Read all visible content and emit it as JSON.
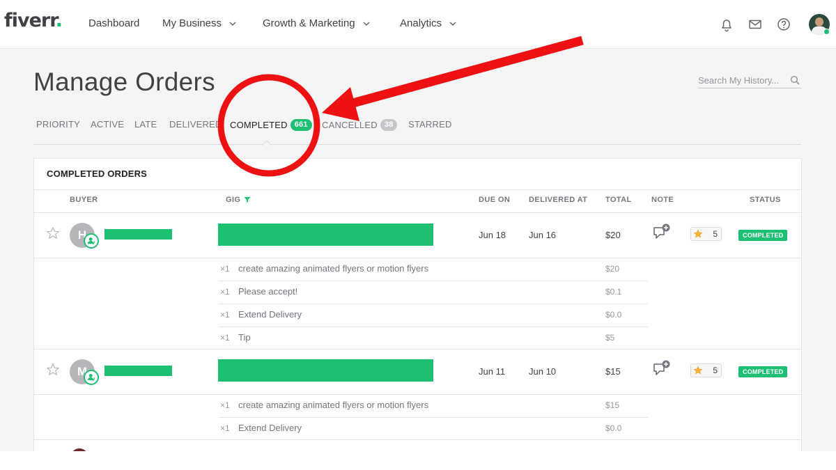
{
  "header": {
    "logo": "fiverr",
    "logo_dot": ".",
    "nav": [
      "Dashboard",
      "My Business",
      "Growth & Marketing",
      "Analytics"
    ]
  },
  "page": {
    "title": "Manage Orders",
    "search_placeholder": "Search My History..."
  },
  "tabs": [
    {
      "label": "PRIORITY"
    },
    {
      "label": "ACTIVE"
    },
    {
      "label": "LATE"
    },
    {
      "label": "DELIVERED"
    },
    {
      "label": "COMPLETED",
      "count": "661"
    },
    {
      "label": "CANCELLED",
      "count": "38"
    },
    {
      "label": "STARRED"
    }
  ],
  "table": {
    "title": "COMPLETED ORDERS",
    "columns": [
      "BUYER",
      "GIG",
      "DUE ON",
      "DELIVERED AT",
      "TOTAL",
      "NOTE",
      "STATUS"
    ],
    "orders": [
      {
        "initial": "H",
        "due": "Jun 18",
        "delivered": "Jun 16",
        "total": "$20",
        "rating": "5",
        "status": "COMPLETED",
        "items": [
          {
            "qty": "×1",
            "title": "create amazing animated flyers or motion flyers",
            "price": "$20"
          },
          {
            "qty": "×1",
            "title": "Please accept!",
            "price": "$0.1"
          },
          {
            "qty": "×1",
            "title": "Extend Delivery",
            "price": "$0.0"
          },
          {
            "qty": "×1",
            "title": "Tip",
            "price": "$5"
          }
        ]
      },
      {
        "initial": "M",
        "due": "Jun 11",
        "delivered": "Jun 10",
        "total": "$15",
        "rating": "5",
        "status": "COMPLETED",
        "items": [
          {
            "qty": "×1",
            "title": "create amazing animated flyers or motion flyers",
            "price": "$15"
          },
          {
            "qty": "×1",
            "title": "Extend Delivery",
            "price": "$0.0"
          }
        ]
      }
    ]
  },
  "colors": {
    "brand_green": "#1dbf73",
    "annotation_red": "#ee1111"
  }
}
